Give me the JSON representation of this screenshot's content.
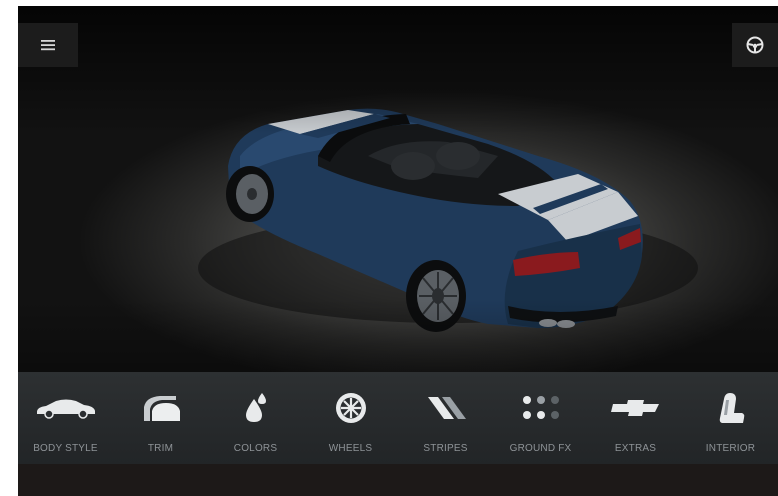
{
  "toolbar": {
    "items": [
      {
        "label": "BODY STYLE",
        "icon": "car-body-icon"
      },
      {
        "label": "TRIM",
        "icon": "trim-icon"
      },
      {
        "label": "COLORS",
        "icon": "paint-drop-icon"
      },
      {
        "label": "WHEELS",
        "icon": "wheel-icon"
      },
      {
        "label": "STRIPES",
        "icon": "stripes-icon"
      },
      {
        "label": "GROUND FX",
        "icon": "ground-fx-icon"
      },
      {
        "label": "EXTRAS",
        "icon": "bowtie-icon"
      },
      {
        "label": "INTERIOR",
        "icon": "seat-icon"
      }
    ]
  },
  "header": {
    "menu_icon": "hamburger-menu-icon",
    "right_icon": "steering-wheel-icon"
  },
  "colors": {
    "car_body": "#1f3a5a",
    "stripe": "#c8ccd0",
    "toolbar_bg": "#272a2c",
    "label": "#8e9397"
  }
}
